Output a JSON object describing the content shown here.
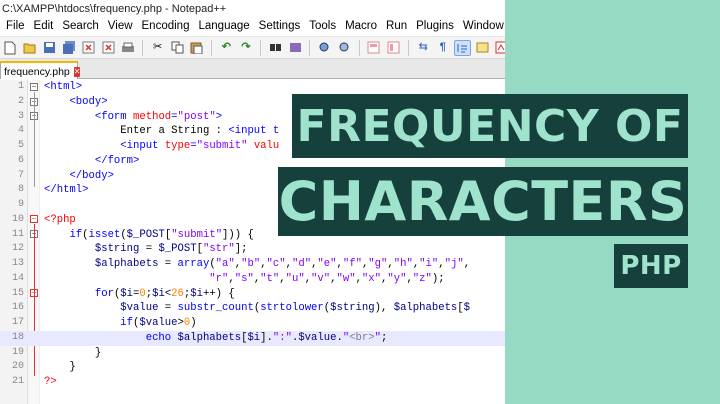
{
  "window": {
    "title": "C:\\XAMPP\\htdocs\\frequency.php - Notepad++"
  },
  "menu": [
    "File",
    "Edit",
    "Search",
    "View",
    "Encoding",
    "Language",
    "Settings",
    "Tools",
    "Macro",
    "Run",
    "Plugins",
    "Window",
    "?"
  ],
  "toolbar_icons": [
    "new-file-icon",
    "open-file-icon",
    "save-icon",
    "save-all-icon",
    "close-icon",
    "close-all-icon",
    "print-icon",
    "cut-icon",
    "copy-icon",
    "paste-icon",
    "undo-icon",
    "redo-icon",
    "find-icon",
    "replace-icon",
    "zoom-in-icon",
    "zoom-out-icon",
    "sync-v-icon",
    "sync-h-icon",
    "wrap-icon",
    "all-chars-icon",
    "indent-guide-icon",
    "udl-icon",
    "doc-map-icon"
  ],
  "tab": {
    "label": "frequency.php"
  },
  "editor": {
    "line_numbers": [
      "1",
      "2",
      "3",
      "4",
      "5",
      "6",
      "7",
      "8",
      "9",
      "10",
      "11",
      "12",
      "13",
      "14",
      "15",
      "16",
      "17",
      "18",
      "19",
      "20",
      "21"
    ],
    "current_line": 18
  },
  "banner": {
    "line1": "FREQUENCY OF",
    "line2": "CHARACTERS",
    "line3": "PHP"
  },
  "colors": {
    "background_right": "#96dac4",
    "banner_bg": "#16403b",
    "banner_text": "#9fe3cd"
  }
}
